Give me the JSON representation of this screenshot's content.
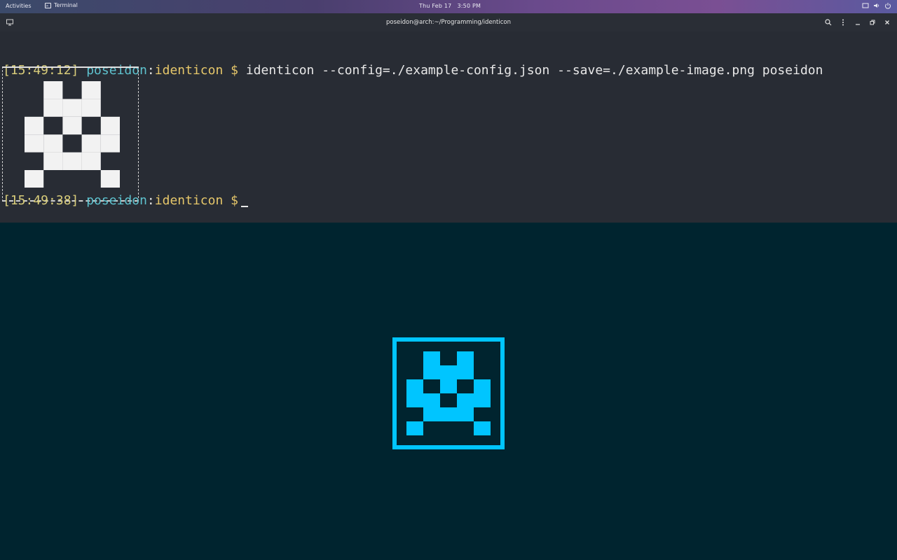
{
  "topbar": {
    "activities": "Activities",
    "app_name": "Terminal",
    "date": "Thu Feb 17",
    "time": "3:50 PM",
    "tray_icons": [
      "screen-icon",
      "volume-icon",
      "power-icon"
    ]
  },
  "window": {
    "title": "poseidon@arch:~/Programming/identicon",
    "controls": [
      "search-icon",
      "menu-icon",
      "minimize-icon",
      "restore-icon",
      "close-icon"
    ]
  },
  "terminal": {
    "line1": {
      "timestamp": "[15:49:12]",
      "user": "poseidon",
      "sep": ":",
      "dir": "identicon",
      "prompt": "$",
      "command": "identicon --config=./example-config.json --save=./example-image.png poseidon"
    },
    "line2": {
      "timestamp": "[15:49:38]",
      "user": "poseidon",
      "sep": ":",
      "dir": "identicon",
      "prompt": "$"
    }
  },
  "identicon": {
    "grid": [
      [
        0,
        1,
        0,
        1,
        0
      ],
      [
        0,
        1,
        1,
        1,
        0
      ],
      [
        1,
        0,
        1,
        0,
        1
      ],
      [
        1,
        1,
        0,
        1,
        1
      ],
      [
        0,
        1,
        1,
        1,
        0
      ],
      [
        1,
        0,
        0,
        0,
        1
      ]
    ],
    "preview_grid": [
      [
        0,
        1,
        0,
        1,
        0
      ],
      [
        0,
        1,
        1,
        1,
        0
      ],
      [
        1,
        0,
        1,
        0,
        1
      ],
      [
        1,
        1,
        0,
        1,
        1
      ],
      [
        0,
        1,
        1,
        1,
        0
      ],
      [
        1,
        0,
        0,
        0,
        1
      ]
    ],
    "terminal_color": "#f2f2f2",
    "preview_color": "#00c5ff",
    "background_color": "#00242f"
  }
}
